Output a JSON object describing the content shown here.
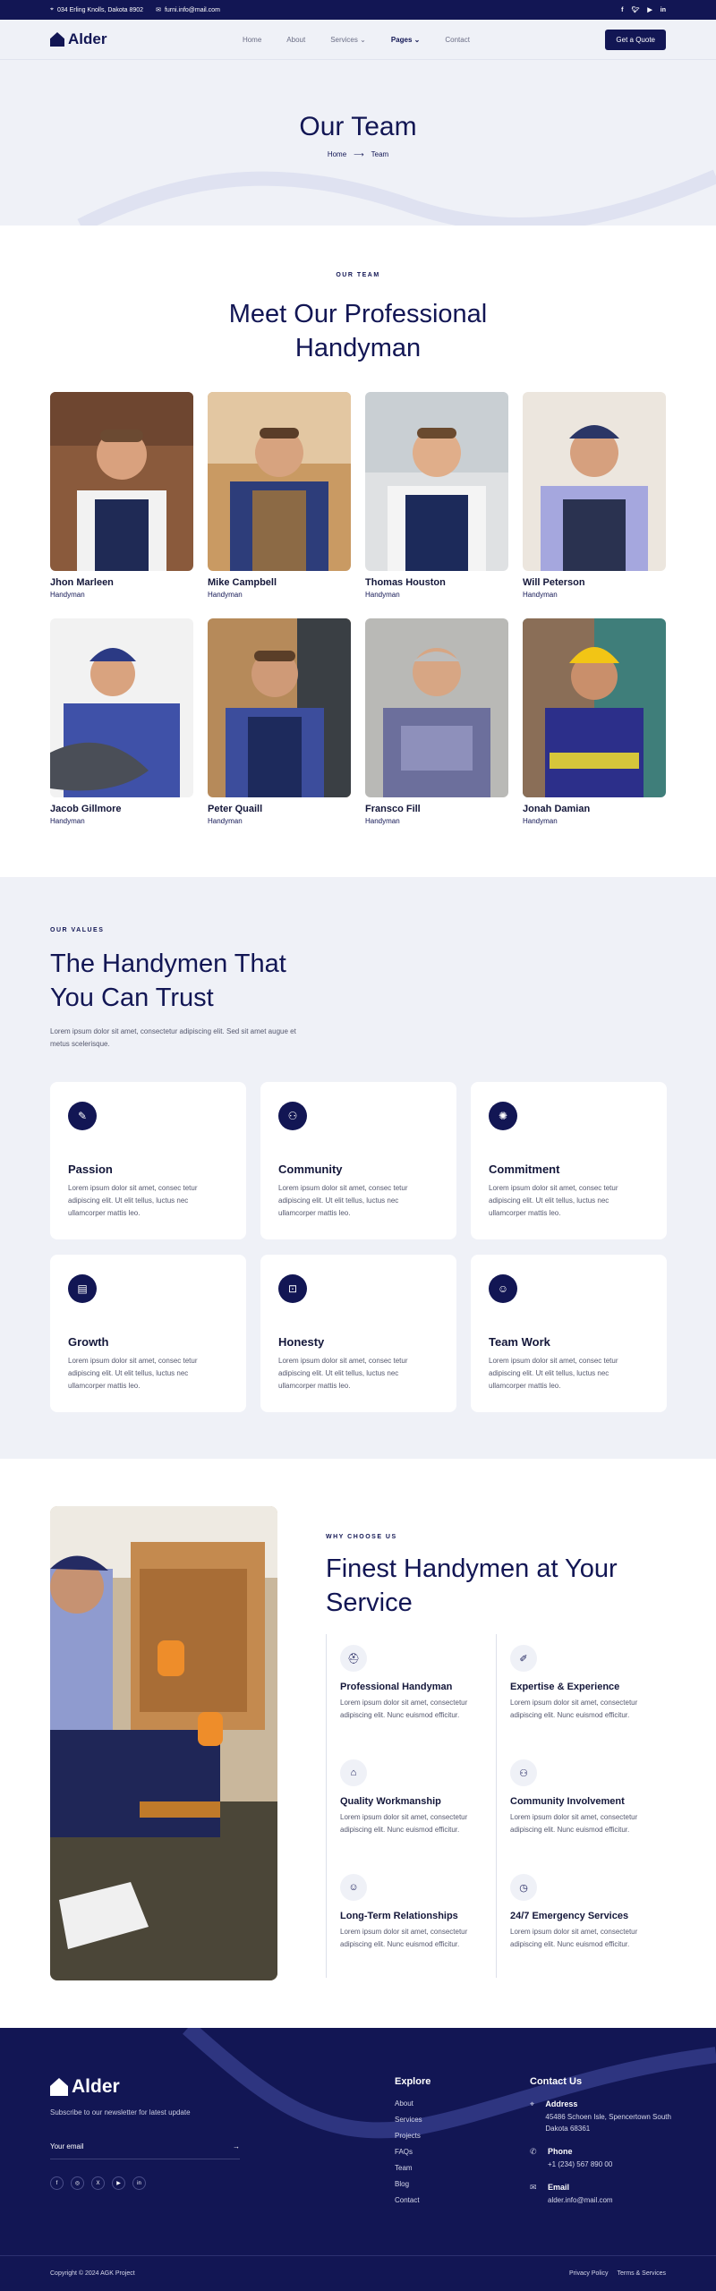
{
  "topbar": {
    "address": "034 Erling Knolls, Dakota 8902",
    "email": "furni.info@mail.com",
    "socials": [
      "f",
      "t",
      "yt",
      "in"
    ]
  },
  "header": {
    "brand": "Alder",
    "nav": [
      "Home",
      "About",
      "Services",
      "Pages",
      "Contact"
    ],
    "cta": "Get a Quote"
  },
  "hero": {
    "title": "Our Team",
    "crumb_home": "Home",
    "crumb_current": "Team"
  },
  "team": {
    "eyebrow": "OUR TEAM",
    "title_line1": "Meet Our Professional",
    "title_line2": "Handyman",
    "members": [
      {
        "name": "Jhon Marleen",
        "role": "Handyman"
      },
      {
        "name": "Mike Campbell",
        "role": "Handyman"
      },
      {
        "name": "Thomas Houston",
        "role": "Handyman"
      },
      {
        "name": "Will Peterson",
        "role": "Handyman"
      },
      {
        "name": "Jacob Gillmore",
        "role": "Handyman"
      },
      {
        "name": "Peter Quaill",
        "role": "Handyman"
      },
      {
        "name": "Fransco Fill",
        "role": "Handyman"
      },
      {
        "name": "Jonah Damian",
        "role": "Handyman"
      }
    ]
  },
  "values": {
    "eyebrow": "OUR VALUES",
    "title_line1": "The Handymen That",
    "title_line2": "You Can Trust",
    "lead": "Lorem ipsum dolor sit amet, consectetur adipiscing elit. Sed sit amet augue et metus scelerisque.",
    "cards": [
      {
        "icon": "pen-icon",
        "glyph": "✎",
        "title": "Passion",
        "text": "Lorem ipsum dolor sit amet, consec tetur adipiscing elit. Ut elit tellus, luctus nec ullamcorper mattis leo."
      },
      {
        "icon": "community-icon",
        "glyph": "⚇",
        "title": "Community",
        "text": "Lorem ipsum dolor sit amet, consec tetur adipiscing elit. Ut elit tellus, luctus nec ullamcorper mattis leo."
      },
      {
        "icon": "commitment-icon",
        "glyph": "✺",
        "title": "Commitment",
        "text": "Lorem ipsum dolor sit amet, consec tetur adipiscing elit. Ut elit tellus, luctus nec ullamcorper mattis leo."
      },
      {
        "icon": "growth-chart-icon",
        "glyph": "▤",
        "title": "Growth",
        "text": "Lorem ipsum dolor sit amet, consec tetur adipiscing elit. Ut elit tellus, luctus nec ullamcorper mattis leo."
      },
      {
        "icon": "lock-icon",
        "glyph": "⊡",
        "title": "Honesty",
        "text": "Lorem ipsum dolor sit amet, consec tetur adipiscing elit. Ut elit tellus, luctus nec ullamcorper mattis leo."
      },
      {
        "icon": "user-icon",
        "glyph": "☺",
        "title": "Team Work",
        "text": "Lorem ipsum dolor sit amet, consec tetur adipiscing elit. Ut elit tellus, luctus nec ullamcorper mattis leo."
      }
    ]
  },
  "why": {
    "eyebrow": "WHY CHOOSE US",
    "title_line1": "Finest Handymen at Your",
    "title_line2": "Service",
    "features": [
      {
        "icon": "helmet-icon",
        "glyph": "⛑",
        "title": "Professional Handyman",
        "text": "Lorem ipsum dolor sit amet, consectetur adipiscing elit. Nunc euismod efficitur."
      },
      {
        "icon": "wrench-icon",
        "glyph": "✐",
        "title": "Expertise & Experience",
        "text": "Lorem ipsum dolor sit amet, consectetur adipiscing elit. Nunc euismod efficitur."
      },
      {
        "icon": "house-icon",
        "glyph": "⌂",
        "title": "Quality Workmanship",
        "text": "Lorem ipsum dolor sit amet, consectetur adipiscing elit. Nunc euismod efficitur."
      },
      {
        "icon": "people-icon",
        "glyph": "⚇",
        "title": "Community Involvement",
        "text": "Lorem ipsum dolor sit amet, consectetur adipiscing elit. Nunc euismod efficitur."
      },
      {
        "icon": "smile-icon",
        "glyph": "☺",
        "title": "Long-Term Relationships",
        "text": "Lorem ipsum dolor sit amet, consectetur adipiscing elit. Nunc euismod efficitur."
      },
      {
        "icon": "clock-icon",
        "glyph": "◷",
        "title": "24/7 Emergency Services",
        "text": "Lorem ipsum dolor sit amet, consectetur adipiscing elit. Nunc euismod efficitur."
      }
    ]
  },
  "footer": {
    "brand": "Alder",
    "subscribe_text": "Subscribe to our newsletter for latest update",
    "email_placeholder": "Your email",
    "socials": [
      "f",
      "◎",
      "X",
      "▶",
      "in"
    ],
    "explore_title": "Explore",
    "explore_links": [
      "About",
      "Services",
      "Projects",
      "FAQs",
      "Team",
      "Blog",
      "Contact"
    ],
    "contact_title": "Contact Us",
    "address_label": "Address",
    "address_value": "45486 Schoen Isle, Spencertown South Dakota 68361",
    "phone_label": "Phone",
    "phone_value": "+1 (234) 567 890 00",
    "email_label": "Email",
    "email_value": "alder.info@mail.com",
    "copyright": "Copyright © 2024 AGK Project",
    "privacy": "Privacy Policy",
    "terms": "Terms & Services"
  }
}
